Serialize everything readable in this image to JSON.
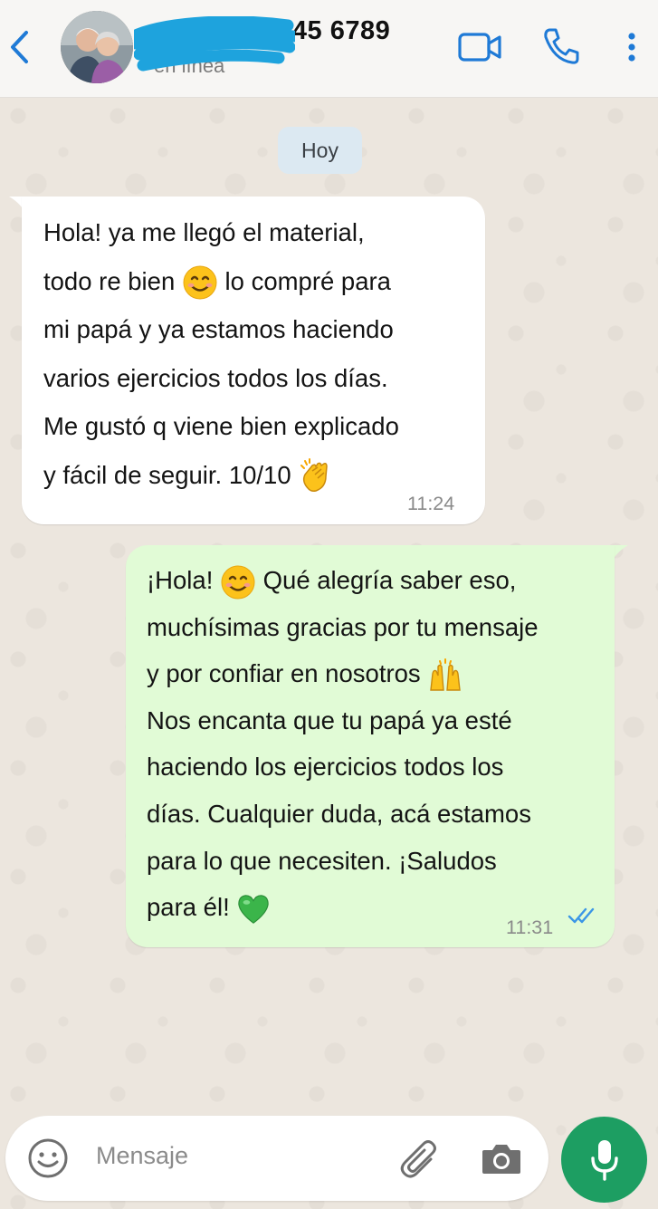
{
  "header": {
    "contact_name": "+54 9 11 2345 6789",
    "contact_status": "en línea",
    "back_icon": "chevron-left-icon",
    "video_icon": "video-camera-icon",
    "call_icon": "phone-icon",
    "menu_icon": "more-vertical-icon"
  },
  "chat": {
    "date_label": "Hoy",
    "messages": [
      {
        "direction": "incoming",
        "lines": [
          "Hola! ya me llegó el material,",
          "todo re bien",
          "lo compré para",
          "mi papá y ya estamos haciendo",
          "varios ejercicios todos los días.",
          "Me gustó q viene bien explicado",
          "y fácil de seguir. 10/10"
        ],
        "time": "11:24"
      },
      {
        "direction": "outgoing",
        "lines": [
          "¡Hola!",
          "Qué alegría saber eso,",
          "muchísimas gracias por tu mensaje",
          "y por confiar en nosotros",
          "Nos encanta que tu papá ya esté",
          "haciendo los ejercicios todos los",
          "días. Cualquier duda, acá estamos",
          "para lo que necesiten. ¡Saludos",
          "para él!"
        ],
        "time": "11:31",
        "status": "read"
      }
    ]
  },
  "composer": {
    "placeholder": "Mensaje",
    "emoji_icon": "emoji-icon",
    "attach_icon": "paperclip-icon",
    "camera_icon": "camera-icon",
    "mic_icon": "microphone-icon"
  },
  "colors": {
    "accent_blue": "#1f7ad6",
    "outgoing_bubble": "#e1fbd6",
    "incoming_bubble": "#ffffff",
    "mic_button": "#1d9e62",
    "read_ticks": "#3b96e6"
  }
}
